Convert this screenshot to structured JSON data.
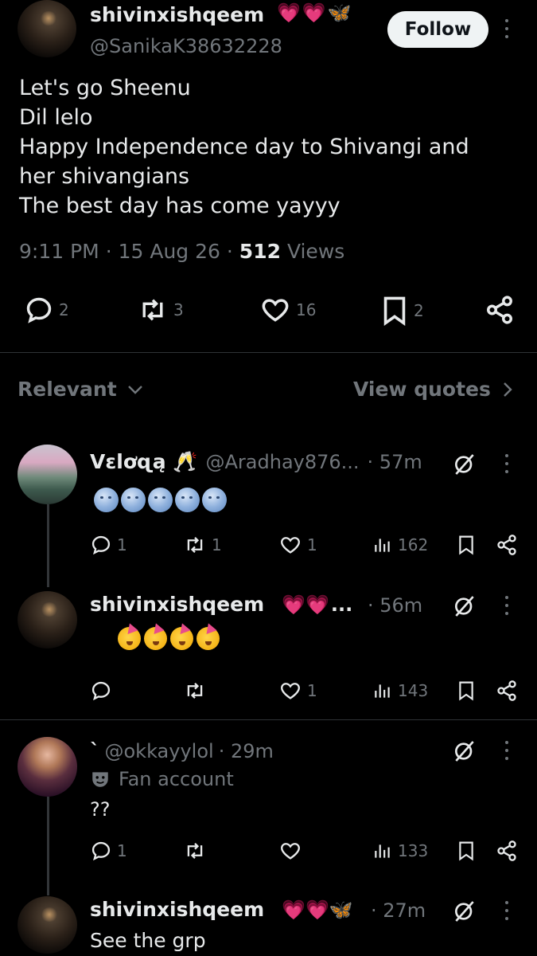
{
  "main_tweet": {
    "display_name": "shivinxishqeem",
    "handle": "@SanikaK38632228",
    "name_emojis": "💗💗🦋",
    "follow_label": "Follow",
    "text_lines": [
      "Let's go Sheenu",
      "Dil lelo",
      "Happy Independence day to Shivangi and",
      "her shivangians",
      "The best day has come yayyy"
    ],
    "time": "9:11 PM",
    "date": "15 Aug 26",
    "views_count": "512",
    "views_label": "Views",
    "replies": "2",
    "reposts": "3",
    "likes": "16",
    "bookmarks": "2"
  },
  "filter_bar": {
    "sort_label": "Relevant",
    "view_quotes_label": "View quotes"
  },
  "replies": [
    {
      "display_name": "ᐯɛlơɋą 🥂",
      "handle": "@Aradhay876...",
      "time": "· 57m",
      "content_emojis": "🌝🌝🌝🌝🌝",
      "reply_count": "1",
      "repost_count": "1",
      "like_count": "1",
      "views": "162"
    },
    {
      "display_name": "shivinxishqeem",
      "name_suffix": "...",
      "time": "· 56m",
      "content_emojis": "🥳🥳🥳🥳",
      "reply_count": "",
      "repost_count": "",
      "like_count": "1",
      "views": "143"
    },
    {
      "display_name": "`",
      "handle": "@okkayylol",
      "time": "· 29m",
      "badge": "Fan account",
      "text": "??",
      "reply_count": "1",
      "repost_count": "",
      "like_count": "",
      "views": "133"
    },
    {
      "display_name": "shivinxishqeem",
      "time": "· 27m",
      "text": "See the grp"
    }
  ],
  "colors": {
    "background": "#000000",
    "text": "#e7e9ea",
    "muted": "#71767b",
    "divider": "#2f3336",
    "follow_bg": "#eff3f4",
    "heart": "#f0468c"
  }
}
